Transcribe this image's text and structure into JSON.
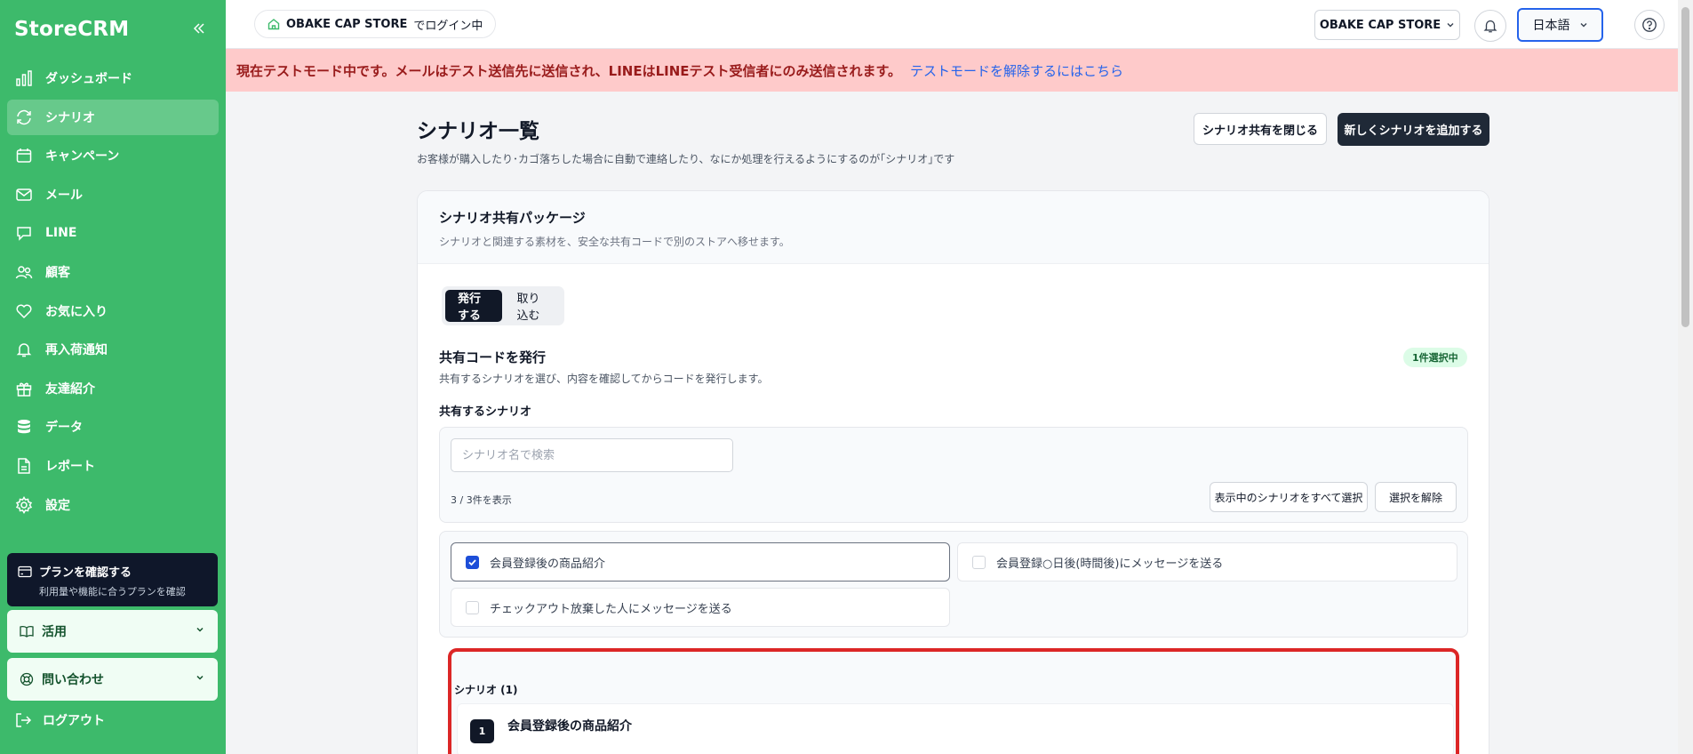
{
  "sidebar": {
    "brand": "StoreCRM",
    "items": [
      {
        "label": "ダッシュボード",
        "icon": "chart-bars-icon"
      },
      {
        "label": "シナリオ",
        "icon": "repeat-icon"
      },
      {
        "label": "キャンペーン",
        "icon": "calendar-icon"
      },
      {
        "label": "メール",
        "icon": "mail-icon"
      },
      {
        "label": "LINE",
        "icon": "chat-icon"
      },
      {
        "label": "顧客",
        "icon": "users-icon"
      },
      {
        "label": "お気に入り",
        "icon": "heart-icon"
      },
      {
        "label": "再入荷通知",
        "icon": "bell-icon"
      },
      {
        "label": "友達紹介",
        "icon": "gift-icon"
      },
      {
        "label": "データ",
        "icon": "database-icon"
      },
      {
        "label": "レポート",
        "icon": "document-icon"
      },
      {
        "label": "設定",
        "icon": "gear-icon"
      }
    ],
    "active_index": 1,
    "plan": {
      "title": "プランを確認する",
      "subtitle": "利用量や機能に合うプランを確認"
    },
    "accordion_use": "活用",
    "accordion_contact": "問い合わせ",
    "logout": "ログアウト"
  },
  "header": {
    "store_name": "OBAKE CAP STORE",
    "login_suffix": "でログイン中",
    "store_select": "OBAKE CAP STORE",
    "language": "日本語"
  },
  "banner": {
    "message": "現在テストモード中です。メールはテスト送信先に送信され、LINEはLINEテスト受信者にのみ送信されます。",
    "link": "テストモードを解除するにはこちら"
  },
  "page": {
    "title": "シナリオ一覧",
    "description": "お客様が購入したり･カゴ落ちした場合に自動で連絡したり、なにか処理を行えるようにするのが｢シナリオ｣です",
    "close_share_button": "シナリオ共有を閉じる",
    "add_button": "新しくシナリオを追加する"
  },
  "share_card": {
    "title": "シナリオ共有パッケージ",
    "subtitle": "シナリオと関連する素材を、安全な共有コードで別のストアへ移せます。",
    "tabs": [
      "発行する",
      "取り込む"
    ],
    "section_title": "共有コードを発行",
    "section_desc": "共有するシナリオを選び、内容を確認してからコードを発行します。",
    "selected_badge": "1件選択中",
    "scenario_label": "共有するシナリオ",
    "search_placeholder": "シナリオ名で検索",
    "count_text": "3 / 3件を表示",
    "select_all_button": "表示中のシナリオをすべて選択",
    "clear_button": "選択を解除",
    "options": [
      {
        "label": "会員登録後の商品紹介",
        "checked": true
      },
      {
        "label": "会員登録○日後(時間後)にメッセージを送る",
        "checked": false
      },
      {
        "label": "チェックアウト放棄した人にメッセージを送る",
        "checked": false
      }
    ],
    "preview_heading": "シナリオ (1)",
    "preview_items": [
      {
        "number": "1",
        "name": "会員登録後の商品紹介"
      }
    ]
  }
}
